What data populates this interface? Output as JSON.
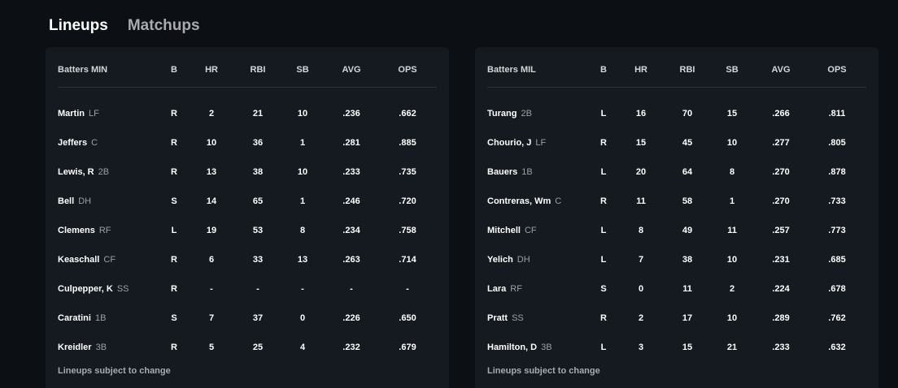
{
  "tabs": [
    {
      "label": "Lineups",
      "active": true
    },
    {
      "label": "Matchups",
      "active": false
    }
  ],
  "columns": [
    "B",
    "HR",
    "RBI",
    "SB",
    "AVG",
    "OPS"
  ],
  "teams": [
    {
      "header": "Batters MIN",
      "rows": [
        {
          "name": "Martin",
          "pos": "LF",
          "b": "R",
          "hr": "2",
          "rbi": "21",
          "sb": "10",
          "avg": ".236",
          "ops": ".662"
        },
        {
          "name": "Jeffers",
          "pos": "C",
          "b": "R",
          "hr": "10",
          "rbi": "36",
          "sb": "1",
          "avg": ".281",
          "ops": ".885"
        },
        {
          "name": "Lewis, R",
          "pos": "2B",
          "b": "R",
          "hr": "13",
          "rbi": "38",
          "sb": "10",
          "avg": ".233",
          "ops": ".735"
        },
        {
          "name": "Bell",
          "pos": "DH",
          "b": "S",
          "hr": "14",
          "rbi": "65",
          "sb": "1",
          "avg": ".246",
          "ops": ".720"
        },
        {
          "name": "Clemens",
          "pos": "RF",
          "b": "L",
          "hr": "19",
          "rbi": "53",
          "sb": "8",
          "avg": ".234",
          "ops": ".758"
        },
        {
          "name": "Keaschall",
          "pos": "CF",
          "b": "R",
          "hr": "6",
          "rbi": "33",
          "sb": "13",
          "avg": ".263",
          "ops": ".714"
        },
        {
          "name": "Culpepper, K",
          "pos": "SS",
          "b": "R",
          "hr": "-",
          "rbi": "-",
          "sb": "-",
          "avg": "-",
          "ops": "-"
        },
        {
          "name": "Caratini",
          "pos": "1B",
          "b": "S",
          "hr": "7",
          "rbi": "37",
          "sb": "0",
          "avg": ".226",
          "ops": ".650"
        },
        {
          "name": "Kreidler",
          "pos": "3B",
          "b": "R",
          "hr": "5",
          "rbi": "25",
          "sb": "4",
          "avg": ".232",
          "ops": ".679"
        }
      ],
      "footer": "Lineups subject to change"
    },
    {
      "header": "Batters MIL",
      "rows": [
        {
          "name": "Turang",
          "pos": "2B",
          "b": "L",
          "hr": "16",
          "rbi": "70",
          "sb": "15",
          "avg": ".266",
          "ops": ".811"
        },
        {
          "name": "Chourio, J",
          "pos": "LF",
          "b": "R",
          "hr": "15",
          "rbi": "45",
          "sb": "10",
          "avg": ".277",
          "ops": ".805"
        },
        {
          "name": "Bauers",
          "pos": "1B",
          "b": "L",
          "hr": "20",
          "rbi": "64",
          "sb": "8",
          "avg": ".270",
          "ops": ".878"
        },
        {
          "name": "Contreras, Wm",
          "pos": "C",
          "b": "R",
          "hr": "11",
          "rbi": "58",
          "sb": "1",
          "avg": ".270",
          "ops": ".733"
        },
        {
          "name": "Mitchell",
          "pos": "CF",
          "b": "L",
          "hr": "8",
          "rbi": "49",
          "sb": "11",
          "avg": ".257",
          "ops": ".773"
        },
        {
          "name": "Yelich",
          "pos": "DH",
          "b": "L",
          "hr": "7",
          "rbi": "38",
          "sb": "10",
          "avg": ".231",
          "ops": ".685"
        },
        {
          "name": "Lara",
          "pos": "RF",
          "b": "S",
          "hr": "0",
          "rbi": "11",
          "sb": "2",
          "avg": ".224",
          "ops": ".678"
        },
        {
          "name": "Pratt",
          "pos": "SS",
          "b": "R",
          "hr": "2",
          "rbi": "17",
          "sb": "10",
          "avg": ".289",
          "ops": ".762"
        },
        {
          "name": "Hamilton, D",
          "pos": "3B",
          "b": "L",
          "hr": "3",
          "rbi": "15",
          "sb": "21",
          "avg": ".233",
          "ops": ".632"
        }
      ],
      "footer": "Lineups subject to change"
    }
  ]
}
